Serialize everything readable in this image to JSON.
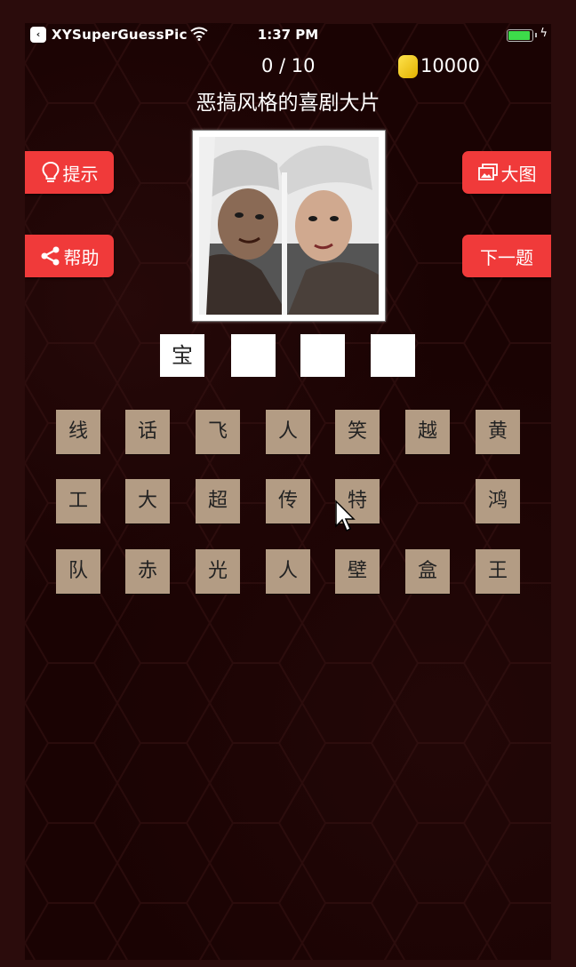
{
  "status_bar": {
    "app_name": "XYSuperGuessPic",
    "time": "1:37 PM",
    "battery_level": 0.95
  },
  "game": {
    "progress": "0 / 10",
    "coins": "10000",
    "title": "恶搞风格的喜剧大片"
  },
  "buttons": {
    "hint": "提示",
    "help": "帮助",
    "big_picture": "大图",
    "next": "下一题"
  },
  "answer_slots": [
    "宝",
    "",
    "",
    ""
  ],
  "letter_grid": [
    [
      "线",
      "话",
      "飞",
      "人",
      "笑",
      "越",
      "黄"
    ],
    [
      "工",
      "大",
      "超",
      "传",
      "特",
      "",
      "鸿"
    ],
    [
      "队",
      "赤",
      "光",
      "人",
      "壁",
      "盒",
      "王"
    ]
  ],
  "colors": {
    "button_red": "#f03a3a",
    "key_tan": "#b39c84",
    "background": "#1a0303"
  }
}
